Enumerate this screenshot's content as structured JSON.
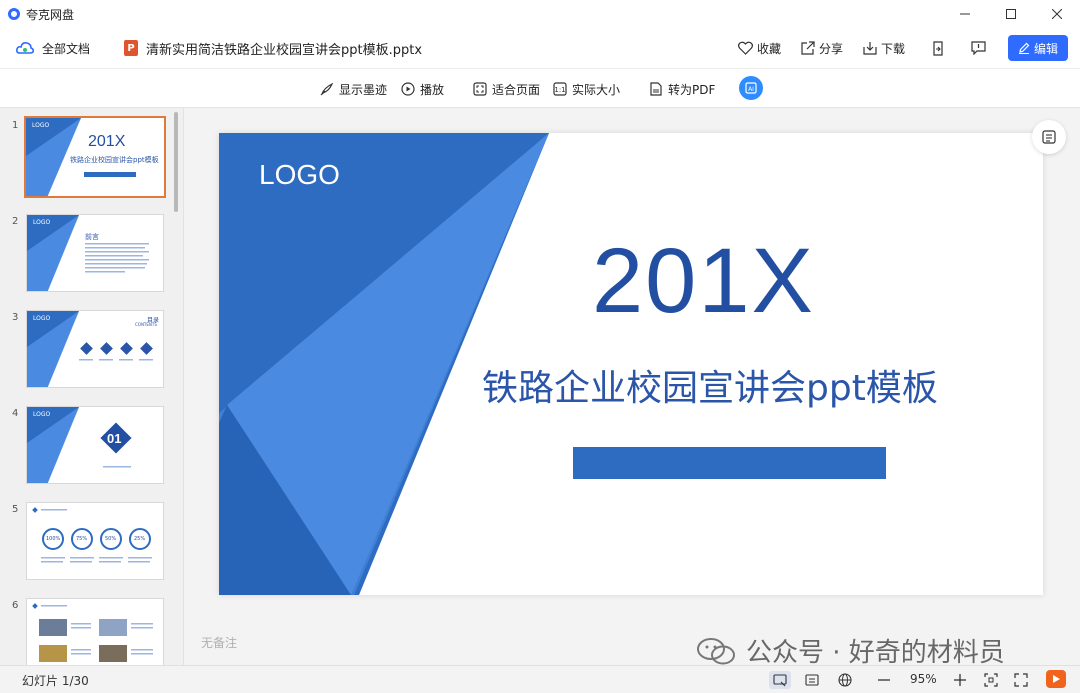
{
  "app": {
    "title": "夸克网盘",
    "accent": "#2f6bff"
  },
  "header": {
    "all_docs": "全部文档",
    "file_name": "清新实用简洁铁路企业校园宣讲会ppt模板.pptx",
    "file_type_letter": "P",
    "actions": {
      "favorite": "收藏",
      "share": "分享",
      "download": "下载",
      "edit": "编辑"
    }
  },
  "toolbar": {
    "show_ink": "显示墨迹",
    "play": "播放",
    "fit_page": "适合页面",
    "actual_size": "实际大小",
    "to_pdf": "转为PDF"
  },
  "sidebar": {
    "thumbnails": [
      {
        "num": "1",
        "logo": "LOGO",
        "title": "201X",
        "subtitle": "铁路企业校园宣讲会ppt模板",
        "active": true
      },
      {
        "num": "2",
        "logo": "LOGO",
        "heading": "前言"
      },
      {
        "num": "3",
        "logo": "LOGO",
        "heading": "目录",
        "heading_en": "CONTENTS"
      },
      {
        "num": "4",
        "logo": "LOGO",
        "number": "01"
      },
      {
        "num": "5",
        "percents": [
          "100%",
          "75%",
          "50%",
          "25%"
        ]
      },
      {
        "num": "6"
      }
    ]
  },
  "slide": {
    "logo": "LOGO",
    "year": "201X",
    "subtitle": "铁路企业校园宣讲会ppt模板",
    "colors": {
      "primary": "#2d6cc0",
      "dark": "#234fa3",
      "light": "#4a8ae0"
    }
  },
  "notes_placeholder": "无备注",
  "watermark": {
    "text": "公众号 · 好奇的材料员"
  },
  "status": {
    "slide_counter": "幻灯片 1/30",
    "zoom": "95%"
  }
}
